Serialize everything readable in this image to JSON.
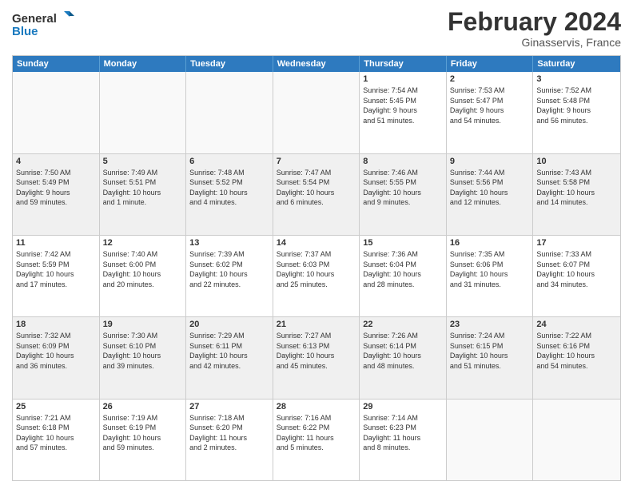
{
  "logo": {
    "line1": "General",
    "line2": "Blue"
  },
  "title": "February 2024",
  "location": "Ginasservis, France",
  "days_of_week": [
    "Sunday",
    "Monday",
    "Tuesday",
    "Wednesday",
    "Thursday",
    "Friday",
    "Saturday"
  ],
  "weeks": [
    {
      "alt": false,
      "cells": [
        {
          "day": "",
          "info": ""
        },
        {
          "day": "",
          "info": ""
        },
        {
          "day": "",
          "info": ""
        },
        {
          "day": "",
          "info": ""
        },
        {
          "day": "1",
          "info": "Sunrise: 7:54 AM\nSunset: 5:45 PM\nDaylight: 9 hours\nand 51 minutes."
        },
        {
          "day": "2",
          "info": "Sunrise: 7:53 AM\nSunset: 5:47 PM\nDaylight: 9 hours\nand 54 minutes."
        },
        {
          "day": "3",
          "info": "Sunrise: 7:52 AM\nSunset: 5:48 PM\nDaylight: 9 hours\nand 56 minutes."
        }
      ]
    },
    {
      "alt": true,
      "cells": [
        {
          "day": "4",
          "info": "Sunrise: 7:50 AM\nSunset: 5:49 PM\nDaylight: 9 hours\nand 59 minutes."
        },
        {
          "day": "5",
          "info": "Sunrise: 7:49 AM\nSunset: 5:51 PM\nDaylight: 10 hours\nand 1 minute."
        },
        {
          "day": "6",
          "info": "Sunrise: 7:48 AM\nSunset: 5:52 PM\nDaylight: 10 hours\nand 4 minutes."
        },
        {
          "day": "7",
          "info": "Sunrise: 7:47 AM\nSunset: 5:54 PM\nDaylight: 10 hours\nand 6 minutes."
        },
        {
          "day": "8",
          "info": "Sunrise: 7:46 AM\nSunset: 5:55 PM\nDaylight: 10 hours\nand 9 minutes."
        },
        {
          "day": "9",
          "info": "Sunrise: 7:44 AM\nSunset: 5:56 PM\nDaylight: 10 hours\nand 12 minutes."
        },
        {
          "day": "10",
          "info": "Sunrise: 7:43 AM\nSunset: 5:58 PM\nDaylight: 10 hours\nand 14 minutes."
        }
      ]
    },
    {
      "alt": false,
      "cells": [
        {
          "day": "11",
          "info": "Sunrise: 7:42 AM\nSunset: 5:59 PM\nDaylight: 10 hours\nand 17 minutes."
        },
        {
          "day": "12",
          "info": "Sunrise: 7:40 AM\nSunset: 6:00 PM\nDaylight: 10 hours\nand 20 minutes."
        },
        {
          "day": "13",
          "info": "Sunrise: 7:39 AM\nSunset: 6:02 PM\nDaylight: 10 hours\nand 22 minutes."
        },
        {
          "day": "14",
          "info": "Sunrise: 7:37 AM\nSunset: 6:03 PM\nDaylight: 10 hours\nand 25 minutes."
        },
        {
          "day": "15",
          "info": "Sunrise: 7:36 AM\nSunset: 6:04 PM\nDaylight: 10 hours\nand 28 minutes."
        },
        {
          "day": "16",
          "info": "Sunrise: 7:35 AM\nSunset: 6:06 PM\nDaylight: 10 hours\nand 31 minutes."
        },
        {
          "day": "17",
          "info": "Sunrise: 7:33 AM\nSunset: 6:07 PM\nDaylight: 10 hours\nand 34 minutes."
        }
      ]
    },
    {
      "alt": true,
      "cells": [
        {
          "day": "18",
          "info": "Sunrise: 7:32 AM\nSunset: 6:09 PM\nDaylight: 10 hours\nand 36 minutes."
        },
        {
          "day": "19",
          "info": "Sunrise: 7:30 AM\nSunset: 6:10 PM\nDaylight: 10 hours\nand 39 minutes."
        },
        {
          "day": "20",
          "info": "Sunrise: 7:29 AM\nSunset: 6:11 PM\nDaylight: 10 hours\nand 42 minutes."
        },
        {
          "day": "21",
          "info": "Sunrise: 7:27 AM\nSunset: 6:13 PM\nDaylight: 10 hours\nand 45 minutes."
        },
        {
          "day": "22",
          "info": "Sunrise: 7:26 AM\nSunset: 6:14 PM\nDaylight: 10 hours\nand 48 minutes."
        },
        {
          "day": "23",
          "info": "Sunrise: 7:24 AM\nSunset: 6:15 PM\nDaylight: 10 hours\nand 51 minutes."
        },
        {
          "day": "24",
          "info": "Sunrise: 7:22 AM\nSunset: 6:16 PM\nDaylight: 10 hours\nand 54 minutes."
        }
      ]
    },
    {
      "alt": false,
      "cells": [
        {
          "day": "25",
          "info": "Sunrise: 7:21 AM\nSunset: 6:18 PM\nDaylight: 10 hours\nand 57 minutes."
        },
        {
          "day": "26",
          "info": "Sunrise: 7:19 AM\nSunset: 6:19 PM\nDaylight: 10 hours\nand 59 minutes."
        },
        {
          "day": "27",
          "info": "Sunrise: 7:18 AM\nSunset: 6:20 PM\nDaylight: 11 hours\nand 2 minutes."
        },
        {
          "day": "28",
          "info": "Sunrise: 7:16 AM\nSunset: 6:22 PM\nDaylight: 11 hours\nand 5 minutes."
        },
        {
          "day": "29",
          "info": "Sunrise: 7:14 AM\nSunset: 6:23 PM\nDaylight: 11 hours\nand 8 minutes."
        },
        {
          "day": "",
          "info": ""
        },
        {
          "day": "",
          "info": ""
        }
      ]
    }
  ]
}
